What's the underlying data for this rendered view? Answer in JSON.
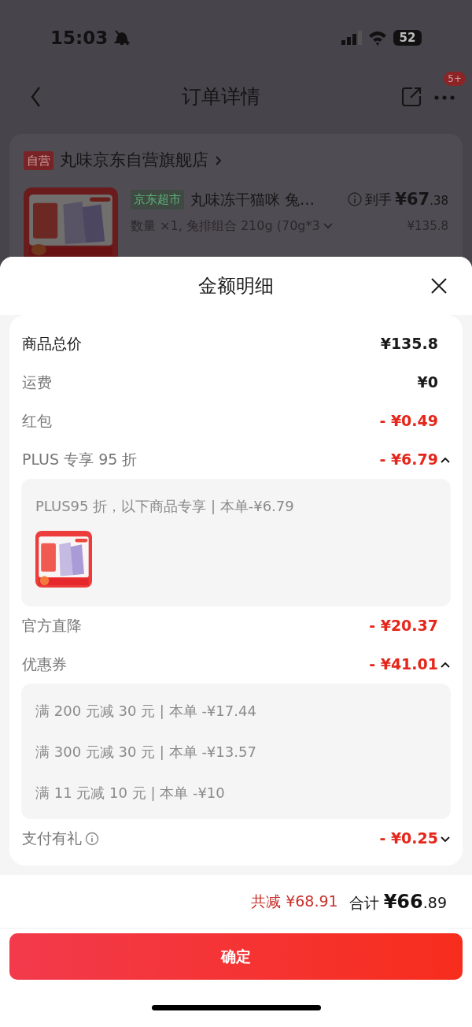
{
  "status_bar": {
    "time": "15:03",
    "battery": "52"
  },
  "header": {
    "title": "订单详情",
    "badge": "5+"
  },
  "store": {
    "tag": "自营",
    "name": "丸味京东自营旗舰店"
  },
  "product": {
    "tag": "京东超市",
    "name": "丸味冻干猫咪 兔…",
    "price_label": "到手",
    "price_main": "¥67",
    "price_decimal": ".38",
    "spec": "数量 ×1, 兔排组合 210g (70g*3",
    "original_price": "¥135.8"
  },
  "sheet": {
    "title": "金额明细",
    "rows": [
      {
        "kind": "total",
        "label": "商品总价",
        "value": "¥135.8"
      },
      {
        "kind": "plain",
        "label": "运费",
        "value": "¥0"
      },
      {
        "kind": "discount",
        "label": "红包",
        "value": "- ¥0.49"
      },
      {
        "kind": "discount",
        "label": "PLUS 专享 95 折",
        "value": "- ¥6.79",
        "expanded": true,
        "details": [
          "PLUS95 折，以下商品专享 | 本单-¥6.79"
        ]
      },
      {
        "kind": "discount",
        "label": "官方直降",
        "value": "- ¥20.37"
      },
      {
        "kind": "discount",
        "label": "优惠券",
        "value": "- ¥41.01",
        "expanded": true,
        "details": [
          "满 200 元减 30 元 | 本单 -¥17.44",
          "满 300 元减 30 元 | 本单 -¥13.57",
          "满 11 元减 10 元 | 本单 -¥10"
        ]
      },
      {
        "kind": "discount",
        "label": "支付有礼",
        "info": true,
        "value": "- ¥0.25",
        "expanded": false
      }
    ]
  },
  "footer": {
    "saved_label": "共减",
    "saved": "¥68.91",
    "total_label": "合计",
    "total_main": "¥66",
    "total_decimal": ".89",
    "button": "确定"
  }
}
